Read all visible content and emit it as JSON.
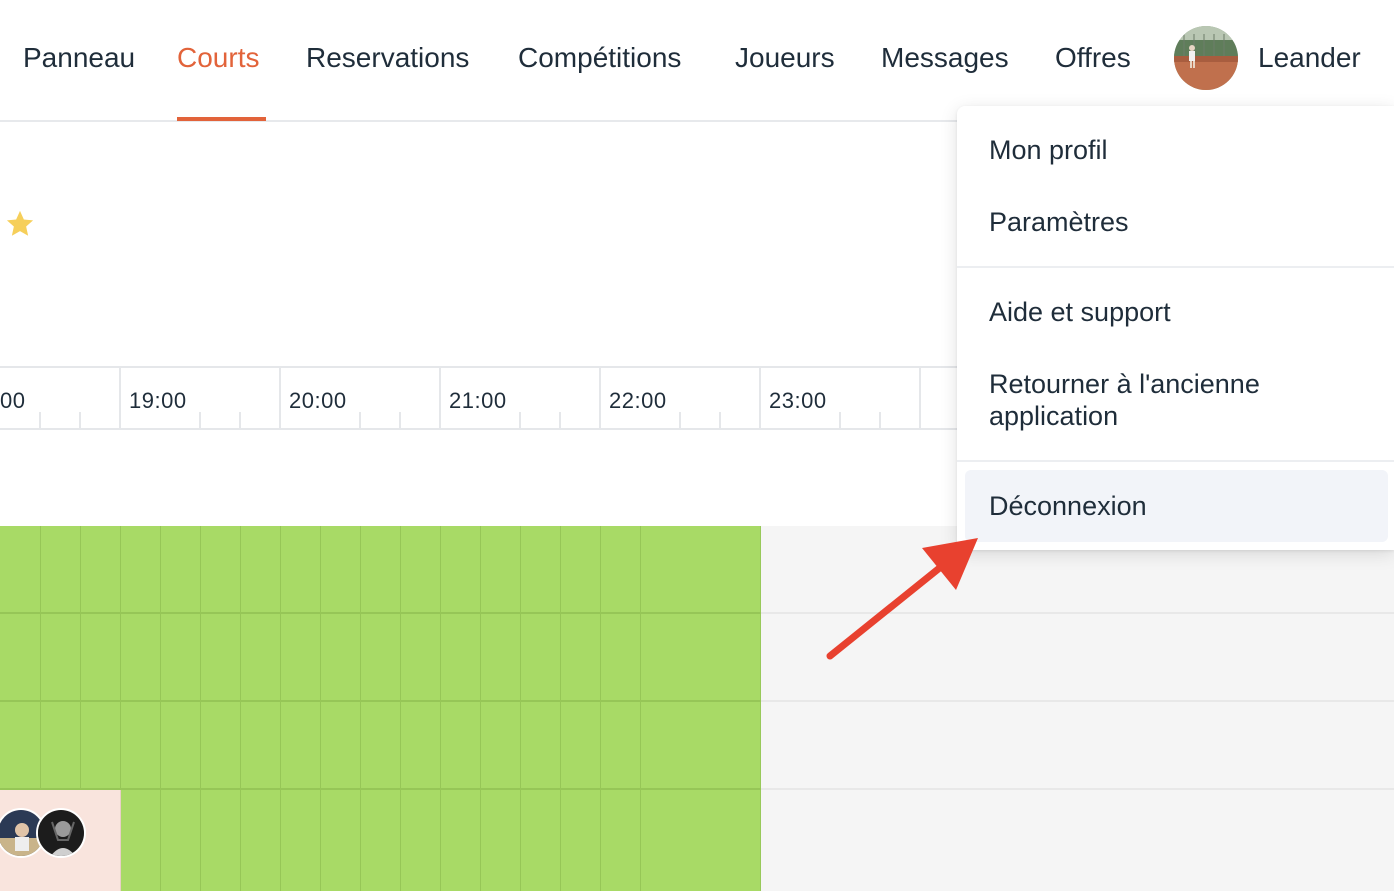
{
  "nav": {
    "items": [
      {
        "label": "Panneau"
      },
      {
        "label": "Courts"
      },
      {
        "label": "Reservations"
      },
      {
        "label": "Compétitions"
      },
      {
        "label": "Joueurs"
      },
      {
        "label": "Messages"
      },
      {
        "label": "Offres"
      }
    ],
    "active": "Courts",
    "user_name": "Leander",
    "accent_color": "#e2633a"
  },
  "favorite_icon": "star-icon",
  "timeline": {
    "labels": [
      "00",
      "19:00",
      "20:00",
      "21:00",
      "22:00",
      "23:00"
    ]
  },
  "grid": {
    "available_color": "#a8da66",
    "booked_color": "#f9e4dd"
  },
  "user_menu": {
    "items": [
      {
        "label": "Mon profil"
      },
      {
        "label": "Paramètres"
      },
      {
        "label": "Aide et support"
      },
      {
        "label": "Retourner à l'ancienne application"
      },
      {
        "label": "Déconnexion"
      }
    ],
    "highlighted": "Déconnexion"
  },
  "annotation": {
    "icon": "red-arrow-icon",
    "color": "#e8412f"
  }
}
